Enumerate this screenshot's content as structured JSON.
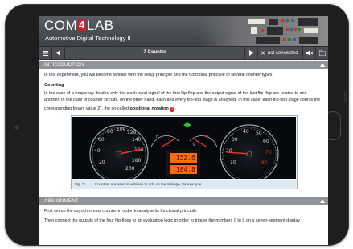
{
  "app": {
    "logo_prefix": "COM",
    "logo_number": "4",
    "logo_suffix": "LAB",
    "subtitle": "Automotive Digital Technology II"
  },
  "nav": {
    "title": "7  Counter",
    "status": "not connected"
  },
  "intro": {
    "header": "INTRODUCTION",
    "paragraph": "In this experiment, you will become familiar with the setup principle and the functional principle of several counter types.",
    "counting_title": "Counting",
    "counting_text": "In the case of a frequency divider, only the clock input signal of the first flip-flop and the output signal of the last flip-flop are related to one another. In the case of counter circuits, on the other hand, each and every flip-flop stage is analysed. In this case, each flip-flop stage counts the corresponding binary value 2",
    "counting_sup": "n",
    "counting_text2": ", the so-called ",
    "counting_bold": "positional notation",
    "hint_badge": "i"
  },
  "figure": {
    "caption_label": "Fig. 1:",
    "caption_text": "Counters are used in vehicles to add up the mileage, for example.",
    "display_top": "152.6",
    "display_bottom": "184.8"
  },
  "assignment": {
    "header": "ASSIGNMENT",
    "line1": "First set up the asynchronous counter in order to analyse its functional principle.",
    "line2": "Then connect the outputs of the four flip-flops to an evaluation logic in order to trigger the numbers 0 to 9 on a seven-segment display"
  },
  "colors": {
    "brand_red": "#d41f26",
    "section_bar": "#8f9296",
    "header_dark": "#3c4047"
  }
}
